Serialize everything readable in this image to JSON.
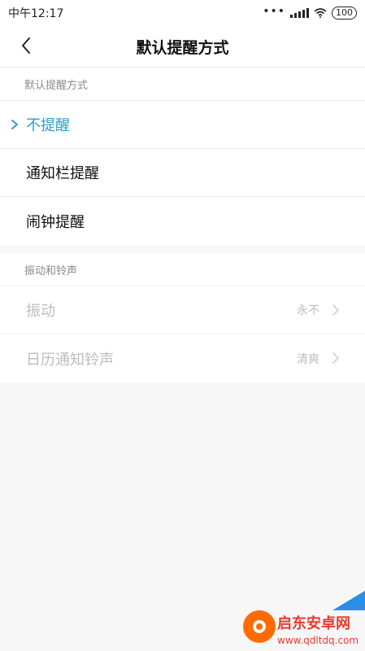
{
  "statusbar": {
    "time": "中午12:17",
    "battery": "100"
  },
  "header": {
    "title": "默认提醒方式"
  },
  "default_section": {
    "header": "默认提醒方式",
    "options": [
      {
        "label": "不提醒",
        "selected": true
      },
      {
        "label": "通知栏提醒",
        "selected": false
      },
      {
        "label": "闹钟提醒",
        "selected": false
      }
    ]
  },
  "vibration_section": {
    "header": "振动和铃声",
    "rows": [
      {
        "label": "振动",
        "value": "永不"
      },
      {
        "label": "日历通知铃声",
        "value": "清爽"
      }
    ]
  },
  "watermark": {
    "text": "启东安卓网",
    "url": "www.qdltdq.com"
  },
  "colors": {
    "accent": "#2f9bd1",
    "disabled": "#bdbdbd"
  }
}
